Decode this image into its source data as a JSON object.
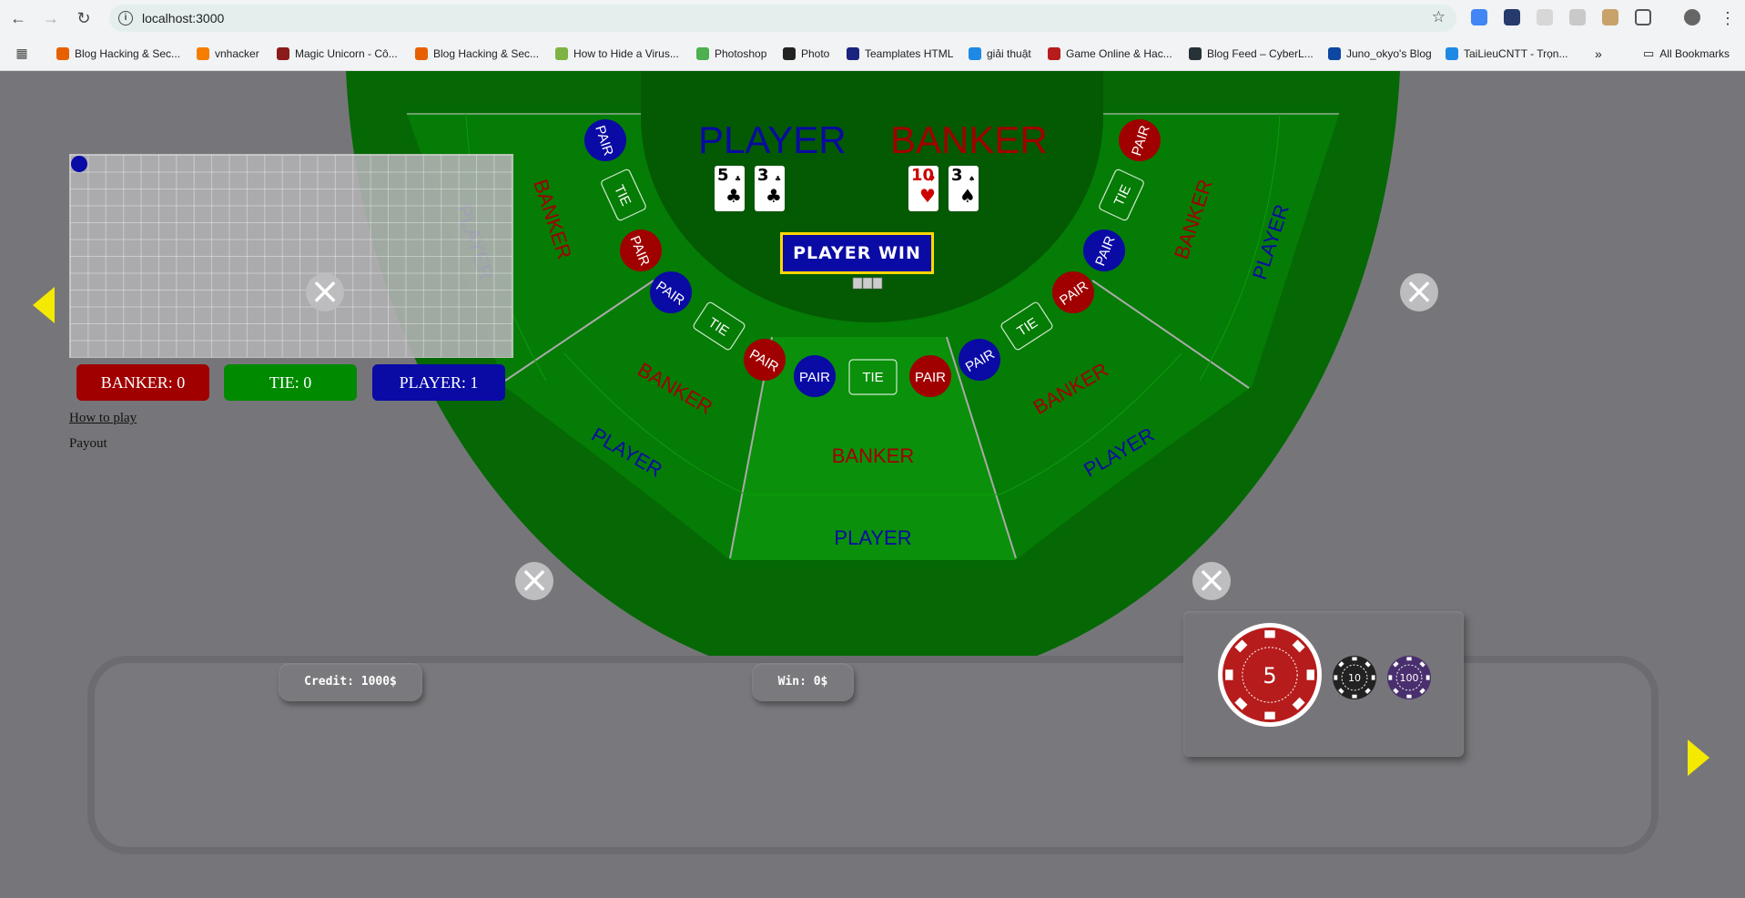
{
  "browser": {
    "url": "localhost:3000",
    "bookmarks": [
      {
        "label": "Blog Hacking & Sec...",
        "color": "#e66000"
      },
      {
        "label": "vnhacker",
        "color": "#f57d00"
      },
      {
        "label": "Magic Unicorn - Cô...",
        "color": "#8b1a1a"
      },
      {
        "label": "Blog Hacking & Sec...",
        "color": "#e66000"
      },
      {
        "label": "How to Hide a Virus...",
        "color": "#7cb342"
      },
      {
        "label": "Photoshop",
        "color": "#4caf50"
      },
      {
        "label": "Photo",
        "color": "#222222"
      },
      {
        "label": "Teamplates HTML",
        "color": "#1a237e"
      },
      {
        "label": "giải thuật",
        "color": "#1e88e5"
      },
      {
        "label": "Game Online & Hac...",
        "color": "#b71c1c"
      },
      {
        "label": "Blog Feed – CyberL...",
        "color": "#263238"
      },
      {
        "label": "Juno_okyo's Blog",
        "color": "#0d47a1"
      },
      {
        "label": "TaiLieuCNTT - Trọn...",
        "color": "#1e88e5"
      }
    ],
    "all_bookmarks": "All Bookmarks"
  },
  "table": {
    "player_label": "PLAYER",
    "banker_label": "BANKER",
    "pair_label": "PAIR",
    "tie_label": "TIE",
    "player_cards": [
      {
        "rank": "5",
        "suit": "♣",
        "color": "#000000"
      },
      {
        "rank": "3",
        "suit": "♣",
        "color": "#000000"
      }
    ],
    "banker_cards": [
      {
        "rank": "10",
        "suit": "♥",
        "color": "#cc0000"
      },
      {
        "rank": "3",
        "suit": "♠",
        "color": "#000000"
      }
    ],
    "result": "PLAYER WIN",
    "colors": {
      "felt_outer": "#056805",
      "felt_dark": "#035a03",
      "felt_mid": "#057c05",
      "felt_light": "#0a900a",
      "player": "#0a0aa5",
      "banker": "#a00000"
    }
  },
  "stats": {
    "banker": "BANKER: 0",
    "tie": "TIE: 0",
    "player": "PLAYER: 1"
  },
  "links": {
    "how_to_play": "How to play",
    "payout": "Payout"
  },
  "wallet": {
    "credit": "Credit: 1000$",
    "win": "Win: 0$"
  },
  "chips": [
    {
      "value": "5",
      "color": "#b71c1c",
      "selected": true
    },
    {
      "value": "10",
      "color": "#222222",
      "selected": false
    },
    {
      "value": "100",
      "color": "#4a2f6e",
      "selected": false
    }
  ]
}
